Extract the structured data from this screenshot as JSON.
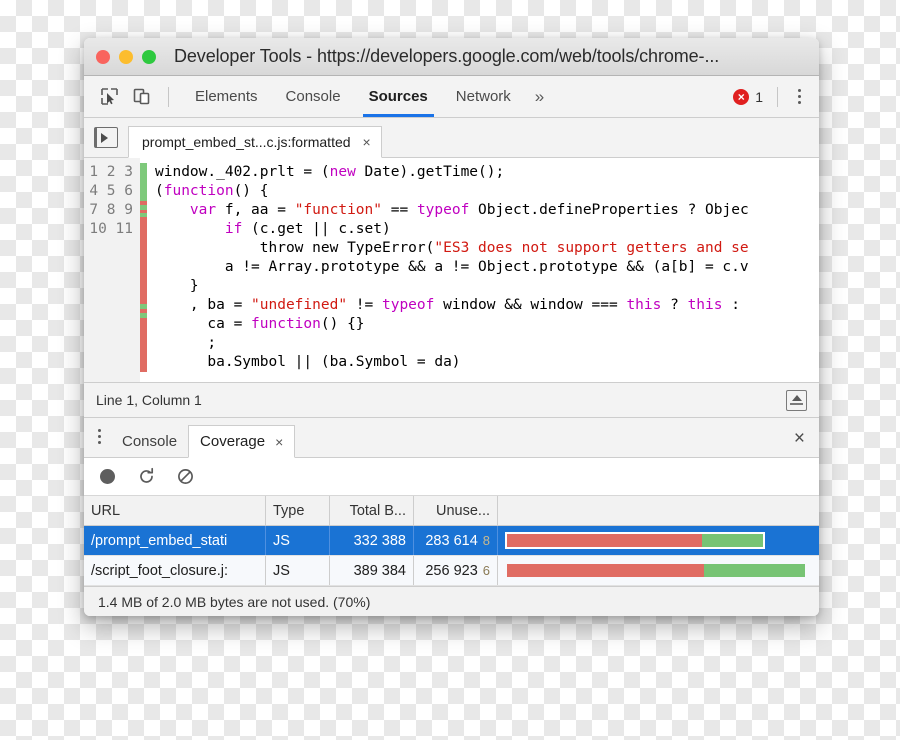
{
  "window": {
    "title": "Developer Tools - https://developers.google.com/web/tools/chrome-...",
    "traffic_lights": [
      "close",
      "minimize",
      "maximize"
    ],
    "colors": {
      "red": "#f9645e",
      "yellow": "#fcbd2e",
      "green": "#2ec93f"
    }
  },
  "main_toolbar": {
    "inspect_icon": "inspect-cursor-icon",
    "device_icon": "device-toolbar-icon",
    "tabs": [
      {
        "label": "Elements",
        "active": false
      },
      {
        "label": "Console",
        "active": false
      },
      {
        "label": "Sources",
        "active": true
      },
      {
        "label": "Network",
        "active": false
      }
    ],
    "more_label": "»",
    "error_icon": "error-circle-icon",
    "error_mark": "×",
    "error_count": "1",
    "menu_icon": "kebab-menu-icon",
    "accent": "#1a73e8"
  },
  "sources": {
    "navigator_toggle_icon": "show-navigator-icon",
    "file_tab": {
      "label": "prompt_embed_st...c.js:formatted",
      "close_label": "×"
    },
    "line_numbers": [
      "1",
      "2",
      "3",
      "4",
      "5",
      "6",
      "7",
      "8",
      "9",
      "10",
      "11"
    ],
    "code_lines": [
      [
        {
          "t": "window._402.prlt = (",
          "c": "plain"
        },
        {
          "t": "new",
          "c": "kw"
        },
        {
          "t": " Date).getTime();",
          "c": "plain"
        }
      ],
      [
        {
          "t": "(",
          "c": "plain"
        },
        {
          "t": "function",
          "c": "kw"
        },
        {
          "t": "() {",
          "c": "plain"
        }
      ],
      [
        {
          "t": "    ",
          "c": "plain"
        },
        {
          "t": "var",
          "c": "kw"
        },
        {
          "t": " f, aa = ",
          "c": "plain"
        },
        {
          "t": "\"function\"",
          "c": "str"
        },
        {
          "t": " == ",
          "c": "plain"
        },
        {
          "t": "typeof",
          "c": "kw"
        },
        {
          "t": " Object.defineProperties ? Objec",
          "c": "plain"
        }
      ],
      [
        {
          "t": "        ",
          "c": "plain"
        },
        {
          "t": "if",
          "c": "kw"
        },
        {
          "t": " (c.get || c.set)",
          "c": "plain"
        }
      ],
      [
        {
          "t": "            ",
          "c": "plain"
        },
        {
          "t": "throw new",
          "c": "plain"
        },
        {
          "t": " TypeError(",
          "c": "plain"
        },
        {
          "t": "\"ES3 does not support getters and se",
          "c": "str"
        }
      ],
      [
        {
          "t": "        a != Array.prototype && a != Object.prototype && (a[b] = c.v",
          "c": "plain"
        }
      ],
      [
        {
          "t": "    }",
          "c": "plain"
        }
      ],
      [
        {
          "t": "    , ba = ",
          "c": "plain"
        },
        {
          "t": "\"undefined\"",
          "c": "str"
        },
        {
          "t": " != ",
          "c": "plain"
        },
        {
          "t": "typeof",
          "c": "kw"
        },
        {
          "t": " window && window === ",
          "c": "plain"
        },
        {
          "t": "this",
          "c": "kw"
        },
        {
          "t": " ? ",
          "c": "plain"
        },
        {
          "t": "this",
          "c": "kw"
        },
        {
          "t": " :",
          "c": "plain"
        }
      ],
      [
        {
          "t": "      ca = ",
          "c": "plain"
        },
        {
          "t": "function",
          "c": "kw"
        },
        {
          "t": "() {}",
          "c": "plain"
        }
      ],
      [
        {
          "t": "      ;",
          "c": "plain"
        }
      ],
      [
        {
          "t": "      ba.Symbol || (ba.Symbol = da)",
          "c": "plain"
        }
      ]
    ],
    "coverage_gutter": [
      {
        "color": "#7ec97b",
        "h": 38
      },
      {
        "color": "#e06c63",
        "h": 4
      },
      {
        "color": "#7ec97b",
        "h": 5
      },
      {
        "color": "#e06c63",
        "h": 3
      },
      {
        "color": "#7ec97b",
        "h": 4
      },
      {
        "color": "#e06c63",
        "h": 87
      },
      {
        "color": "#7ec97b",
        "h": 5
      },
      {
        "color": "#e06c63",
        "h": 4
      },
      {
        "color": "#7ec97b",
        "h": 5
      },
      {
        "color": "#e06c63",
        "h": 54
      }
    ],
    "cursor_position": "Line 1, Column 1",
    "drawer_expand_icon": "expand-drawer-icon"
  },
  "drawer": {
    "menu_icon": "kebab-menu-icon",
    "tabs": [
      {
        "label": "Console",
        "active": false
      },
      {
        "label": "Coverage",
        "active": true,
        "close_label": "×"
      }
    ],
    "close_label": "×"
  },
  "coverage": {
    "toolbar": {
      "record_icon": "record-dot-icon",
      "reload_icon": "reload-icon",
      "clear_icon": "clear-block-icon"
    },
    "columns": [
      "URL",
      "Type",
      "Total B...",
      "Unuse...",
      ""
    ],
    "rows": [
      {
        "url": "/prompt_embed_stati",
        "type": "JS",
        "total_bytes": "332 388",
        "unused_bytes": "283 614",
        "percent": "8",
        "unused_pct": 76,
        "selected": true
      },
      {
        "url": "/script_foot_closure.j:",
        "type": "JS",
        "total_bytes": "389 384",
        "unused_bytes": "256 923",
        "percent": "6",
        "unused_pct": 66,
        "selected": false
      }
    ],
    "status": "1.4 MB of 2.0 MB bytes are not used. (70%)",
    "bar_colors": {
      "unused": "#e06c63",
      "used": "#77c474"
    }
  }
}
